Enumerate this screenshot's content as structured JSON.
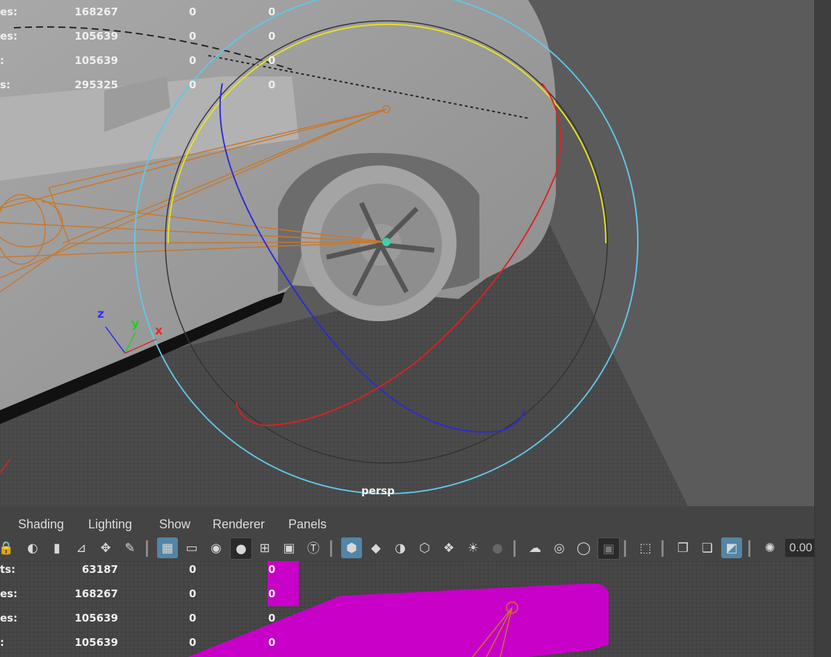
{
  "top_view": {
    "hud_rows": [
      {
        "label": "es:",
        "v1": "168267",
        "v2": "0",
        "v3": "0"
      },
      {
        "label": "es:",
        "v1": "105639",
        "v2": "0",
        "v3": "0"
      },
      {
        "label": ":",
        "v1": "105639",
        "v2": "0",
        "v3": "0"
      },
      {
        "label": "s:",
        "v1": "295325",
        "v2": "0",
        "v3": "0"
      }
    ],
    "camera_label": "persp",
    "axis_labels": {
      "z": "z",
      "y": "y",
      "x": "x"
    }
  },
  "panel_menu": [
    "Shading",
    "Lighting",
    "Show",
    "Renderer",
    "Panels"
  ],
  "toolbar": {
    "field_value": "0.00",
    "icons": [
      "lock-camera-icon",
      "camera-attributes-icon",
      "bookmark-icon",
      "image-plane-icon",
      "move-pivot-icon",
      "grease-pencil-icon",
      "grid-icon",
      "film-gate-icon",
      "resolution-gate-icon",
      "gate-mask-icon",
      "field-chart-icon",
      "safe-action-icon",
      "safe-title-icon",
      "wireframe-icon",
      "smooth-shade-icon",
      "textured-icon",
      "wireframe-on-shaded-icon",
      "xray-icon",
      "lights-icon",
      "shadows-icon",
      "ambient-occlusion-icon",
      "motion-blur-icon",
      "anti-alias-icon",
      "depth-of-field-icon",
      "isolate-select-icon",
      "xray-joints-icon",
      "xray-active-icon",
      "two-sided-lighting-icon",
      "exposure-icon"
    ]
  },
  "bottom_view": {
    "hud_rows": [
      {
        "label": "ts:",
        "v1": "63187",
        "v2": "0",
        "v3": "0"
      },
      {
        "label": "es:",
        "v1": "168267",
        "v2": "0",
        "v3": "0"
      },
      {
        "label": "es:",
        "v1": "105639",
        "v2": "0",
        "v3": "0"
      },
      {
        "label": ":",
        "v1": "105639",
        "v2": "0",
        "v3": "0"
      }
    ]
  },
  "colors": {
    "viewport_bg": "#5a5a5a",
    "grid_bg": "#4a4a4a",
    "selection_magenta": "#c800c8",
    "rotate_x": "#e02020",
    "rotate_y": "#e8e020",
    "rotate_z": "#2a2ad8",
    "rotate_view": "#5fc8e8",
    "rig_orange": "#c8782a",
    "active_button": "#5285a6"
  }
}
